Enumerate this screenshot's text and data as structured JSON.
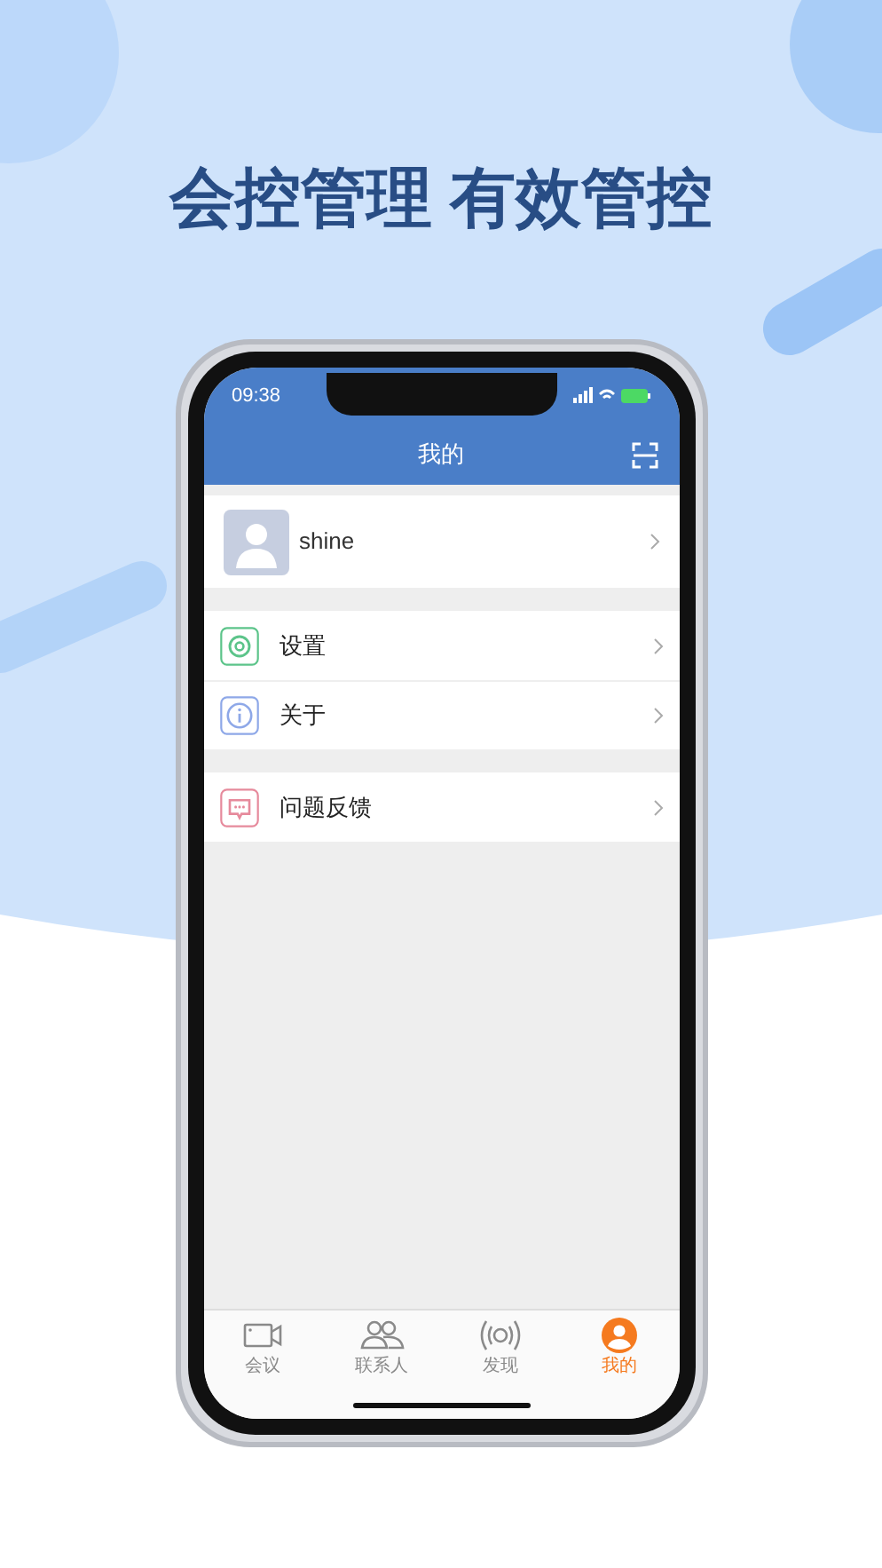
{
  "headline": "会控管理 有效管控",
  "status_bar": {
    "time": "09:38"
  },
  "nav": {
    "title": "我的"
  },
  "profile": {
    "name": "shine"
  },
  "menu_groups": [
    [
      {
        "kind": "settings",
        "label": "设置"
      },
      {
        "kind": "about",
        "label": "关于"
      }
    ],
    [
      {
        "kind": "feedback",
        "label": "问题反馈"
      }
    ]
  ],
  "tabs": [
    {
      "kind": "meeting",
      "label": "会议",
      "selected": false
    },
    {
      "kind": "contacts",
      "label": "联系人",
      "selected": false
    },
    {
      "kind": "discover",
      "label": "发现",
      "selected": false
    },
    {
      "kind": "me",
      "label": "我的",
      "selected": true
    }
  ]
}
